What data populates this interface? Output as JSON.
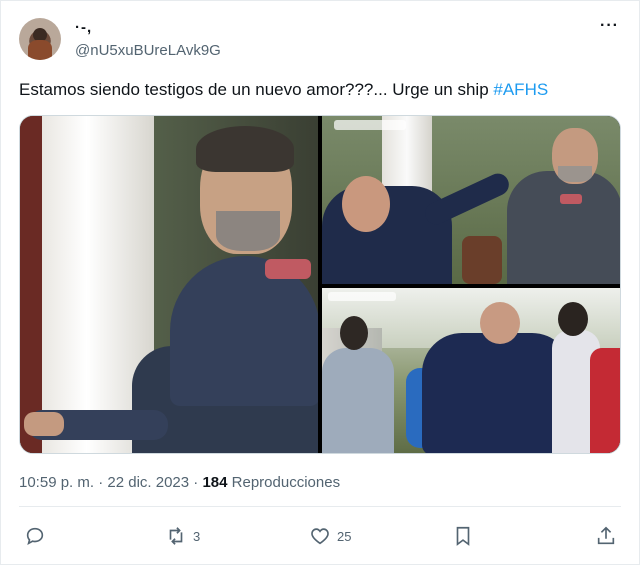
{
  "author": {
    "display_name": "·-,",
    "handle": "@nU5xuBUreLAvk9G"
  },
  "tweet": {
    "text": "Estamos siendo testigos de un nuevo amor???... Urge un ship ",
    "hashtag": "#AFHS"
  },
  "meta": {
    "time": "10:59 p. m.",
    "separator1": " · ",
    "date": "22 dic. 2023",
    "separator2": " · ",
    "views_count": "184",
    "views_label": " Reproducciones"
  },
  "actions": {
    "retweets": "3",
    "likes": "25"
  },
  "icons": {
    "more": "more-icon",
    "reply": "reply-icon",
    "retweet": "retweet-icon",
    "like": "heart-icon",
    "bookmark": "bookmark-icon",
    "share": "share-icon"
  },
  "colors": {
    "accent": "#1d9bf0",
    "text": "#0f1419",
    "secondary": "#536471"
  }
}
